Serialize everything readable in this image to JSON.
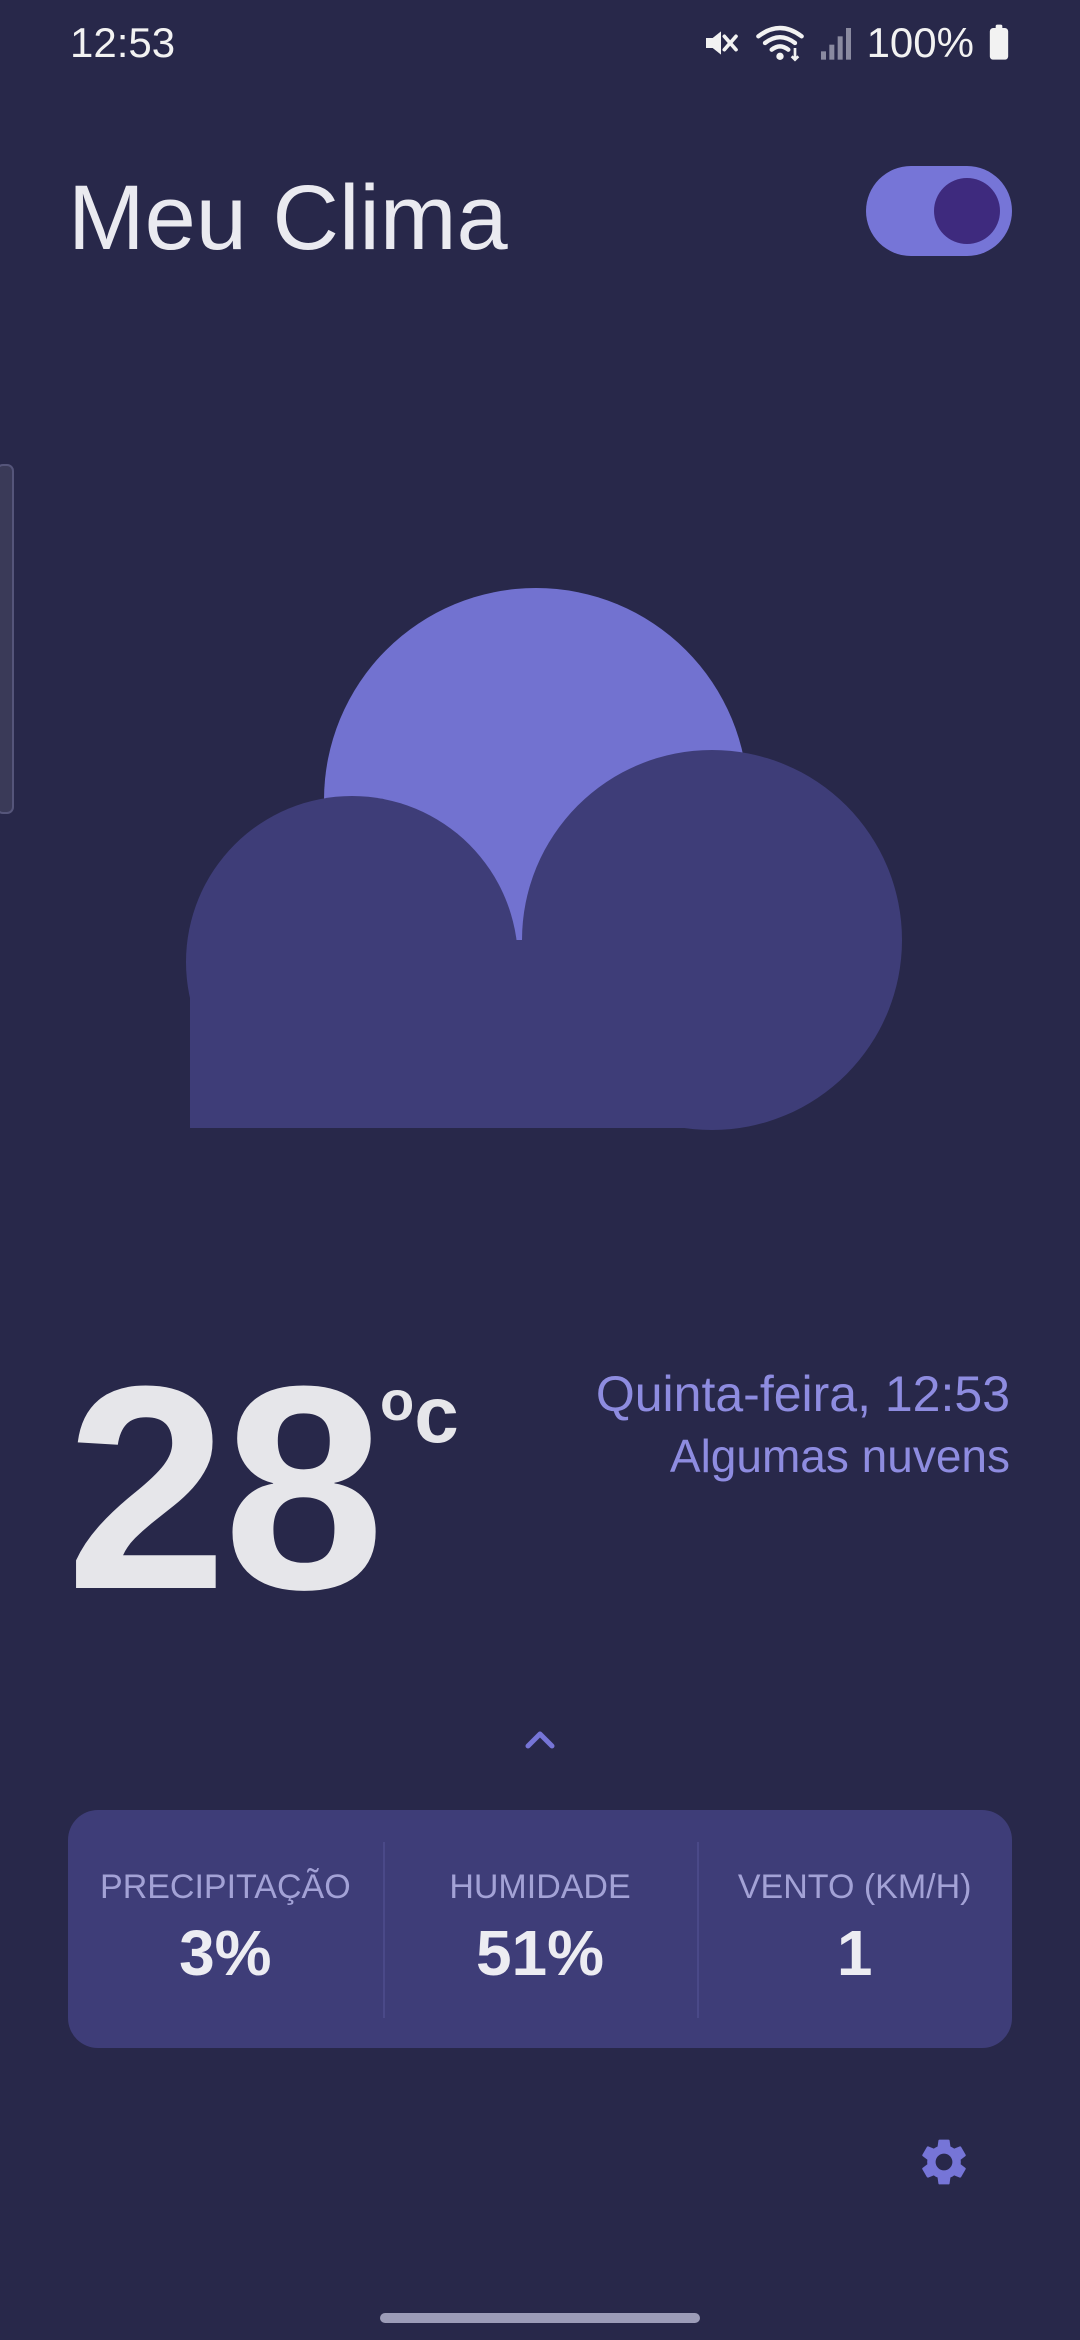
{
  "status_bar": {
    "time": "12:53",
    "battery_text": "100%",
    "icons": [
      "mute-icon",
      "wifi-icon",
      "signal-icon",
      "battery-icon"
    ]
  },
  "header": {
    "title": "Meu Clima",
    "theme_toggle_on": true
  },
  "weather": {
    "icon": "partly-cloudy-icon",
    "temperature": "28",
    "unit_degree": "o",
    "unit_letter": "c",
    "day_time": "Quinta-feira, 12:53",
    "condition": "Algumas nuvens"
  },
  "details": [
    {
      "label": "PRECIPITAÇÃO",
      "value": "3%"
    },
    {
      "label": "HUMIDADE",
      "value": "51%"
    },
    {
      "label": "VENTO (KM/H)",
      "value": "1"
    }
  ],
  "colors": {
    "background": "#28284a",
    "accent": "#7675d7",
    "card": "#3e3d78",
    "cloud": "#3e3d78",
    "secondary_text": "#8e8ce0"
  }
}
